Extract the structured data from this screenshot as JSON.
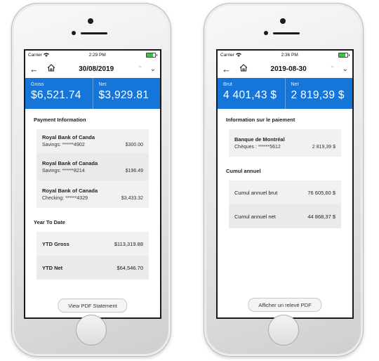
{
  "left": {
    "status": {
      "carrier": "Carrier",
      "time": "2:29 PM"
    },
    "nav": {
      "date": "30/08/2019"
    },
    "summary": {
      "gross_label": "Gross",
      "gross_value": "$6,521.74",
      "net_label": "Net",
      "net_value": "$3,929.81"
    },
    "payment": {
      "title": "Payment Information",
      "items": [
        {
          "bank": "Royal Bank of Canda",
          "account": "Savings: ******4902",
          "amount": "$300.00"
        },
        {
          "bank": "Royal Bank of Canada",
          "account": "Savings: ******8214",
          "amount": "$196.49"
        },
        {
          "bank": "Royal Bank of Canada",
          "account": "Checking: ******4329",
          "amount": "$3,433.32"
        }
      ]
    },
    "ytd": {
      "title": "Year To Date",
      "rows": [
        {
          "label": "YTD Gross",
          "value": "$113,319.88"
        },
        {
          "label": "YTD Net",
          "value": "$64,546.70"
        }
      ]
    },
    "pdf_button": "View PDF Statement"
  },
  "right": {
    "status": {
      "carrier": "Carrier",
      "time": "2:36 PM"
    },
    "nav": {
      "date": "2019-08-30"
    },
    "summary": {
      "gross_label": "Brut",
      "gross_value": "4 401,43 $",
      "net_label": "Net",
      "net_value": "2 819,39 $"
    },
    "payment": {
      "title": "Information sur le paiement",
      "items": [
        {
          "bank": "Banque de Montréal",
          "account": "Chèques : ******5612",
          "amount": "2 819,39 $"
        }
      ]
    },
    "ytd": {
      "title": "Cumul annuel",
      "rows": [
        {
          "label": "Cumul annuel brut",
          "value": "76 605,60 $"
        },
        {
          "label": "Cumul annuel net",
          "value": "44 868,37 $"
        }
      ]
    },
    "pdf_button": "Afficher un relevé PDF"
  },
  "colors": {
    "header_blue": "#1575d8",
    "card_bg": "#f0f1f3"
  },
  "icons": [
    "wifi-icon",
    "battery-icon",
    "back-arrow-icon",
    "home-icon",
    "chevron-up-icon",
    "chevron-down-icon"
  ]
}
